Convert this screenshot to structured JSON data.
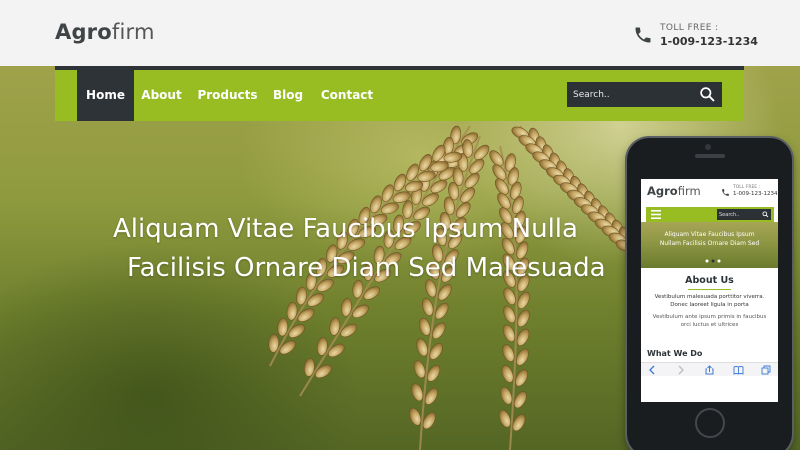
{
  "brand": {
    "name_bold": "Agro",
    "name_light": "firm"
  },
  "contact": {
    "toll_label": "TOLL FREE :",
    "toll_number": "1-009-123-1234"
  },
  "nav": {
    "items": [
      {
        "label": "Home",
        "active": true
      },
      {
        "label": "About",
        "active": false
      },
      {
        "label": "Products",
        "active": false
      },
      {
        "label": "Blog",
        "active": false
      },
      {
        "label": "Contact",
        "active": false
      }
    ],
    "search_placeholder": "Search.."
  },
  "hero": {
    "line1": "Aliquam Vitae Faucibus Ipsum Nulla",
    "line2": "Facilisis Ornare Diam Sed Malesuada"
  },
  "mobile": {
    "brand_bold": "Agro",
    "brand_light": "firm",
    "toll_label": "TOLL FREE :",
    "toll_number": "1-009-123-1234",
    "search_placeholder": "Search..",
    "hero_line1": "Aliquam Vitae Faucibus Ipsum",
    "hero_line2": "Nullam Facilisis Ornare Diam Sed",
    "about_title": "About Us",
    "about_p1": "Vestibulum malesuada porttitor viverra. Donec laoreet ligula in porta",
    "about_p2": "Vestibulum ante ipsum primis in faucibus orci luctus et ultrices",
    "what_title": "What We Do"
  },
  "colors": {
    "accent": "#97bd23",
    "dark": "#2e3338",
    "header_bg": "#f3f3f3"
  }
}
